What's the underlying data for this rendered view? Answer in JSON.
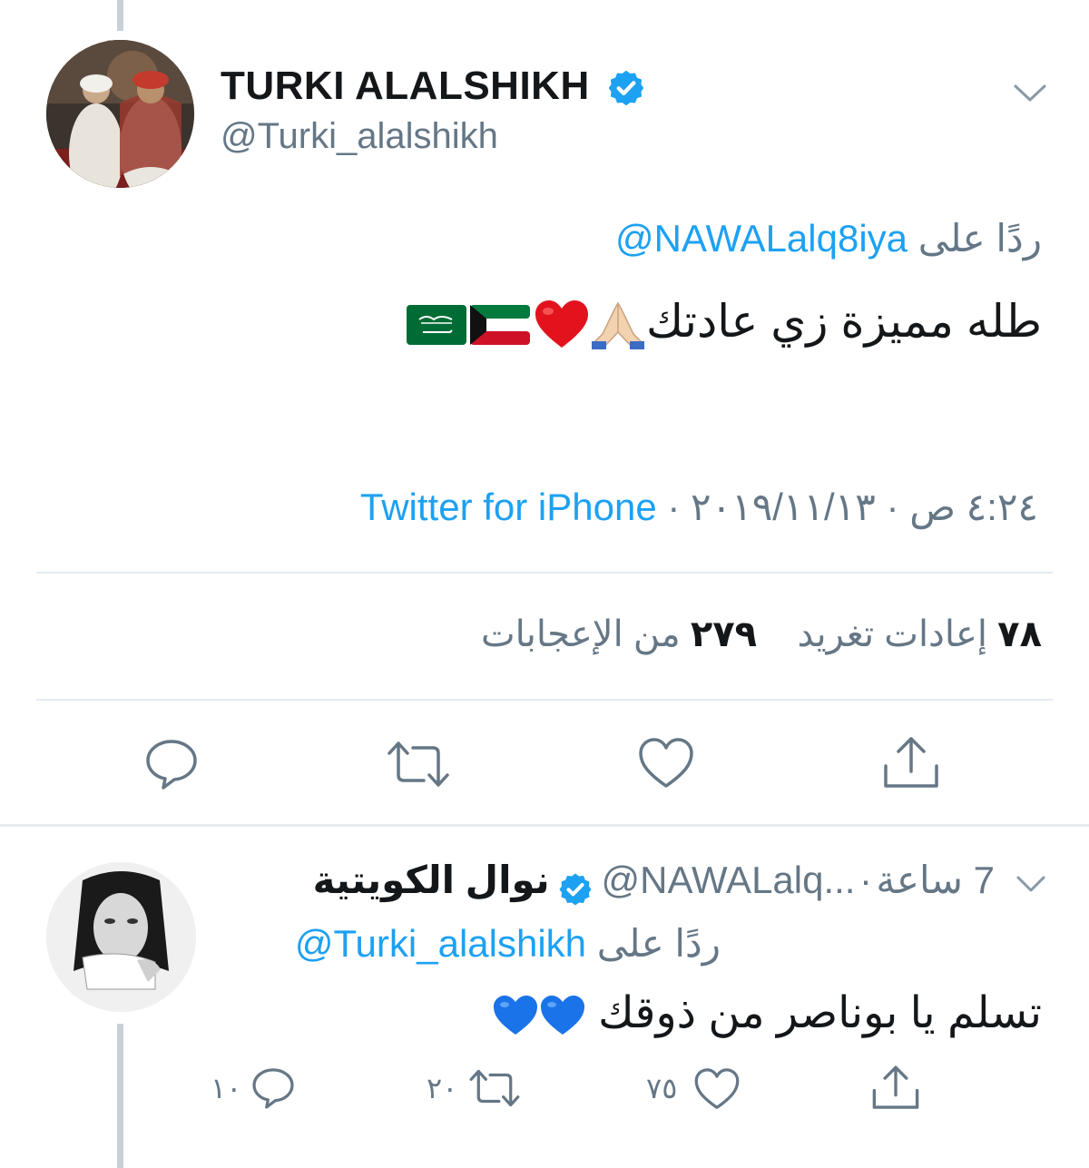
{
  "tweet": {
    "author_name": "TURKI ALALSHIKH",
    "author_handle": "@Turki_alalshikh",
    "reply_prefix": "ردًا على",
    "reply_to": "@NAWALalq8iya",
    "text": "طله مميزة زي عادتك",
    "time": "٤:٢٤ ص",
    "date": "٢٠١٩/١١/١٣",
    "separator": "·",
    "source": "Twitter for iPhone",
    "retweets_count": "٧٨",
    "retweets_label": "إعادات تغريد",
    "likes_count": "٢٧٩",
    "likes_label": "من الإعجابات"
  },
  "reply": {
    "author_name": "نوال الكويتية",
    "author_handle": "@NAWALalq...",
    "separator": "·",
    "time": "7 ساعة",
    "reply_prefix": "ردًا على",
    "reply_to": "@Turki_alalshikh",
    "text": "تسلم يا بوناصر من ذوقك",
    "replies_count": "١٠",
    "retweets_count": "٢٠",
    "likes_count": "٧٥"
  },
  "icons": {
    "verified": "verified-badge-icon",
    "chevron": "chevron-down-icon",
    "reply": "reply-icon",
    "retweet": "retweet-icon",
    "like": "like-icon",
    "share": "share-icon"
  },
  "colors": {
    "accent": "#1da1f2",
    "secondary_text": "#657786",
    "primary_text": "#14171a",
    "divider": "#e6ecf0"
  }
}
